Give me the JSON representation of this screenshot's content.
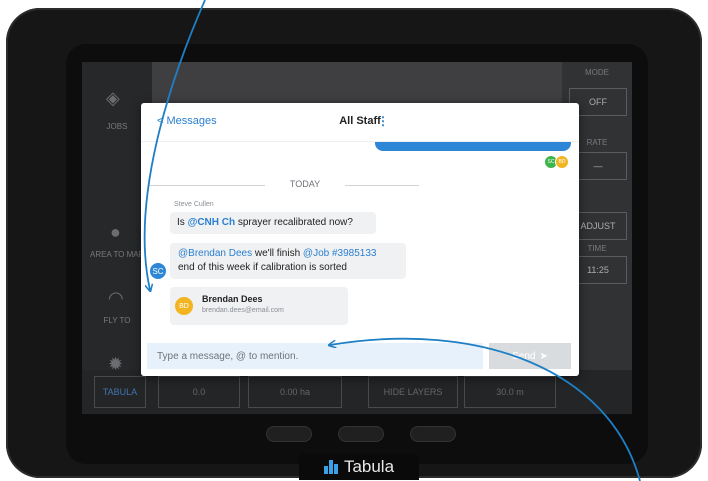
{
  "background": {
    "left_items": [
      "JOBS",
      "AREA TO MAP",
      "FLY TO"
    ],
    "right_values": [
      "OFF",
      "—",
      "11:25"
    ],
    "right_labels": [
      "MODE",
      "RATE",
      "TIME"
    ],
    "right_button": "ADJUST",
    "bottom_values": [
      "0.0",
      "0.00 ha",
      "HIDE LAYERS",
      "30.0 m"
    ],
    "bottom_left": "TABULA"
  },
  "header": {
    "back_label": "< Messages",
    "title": "All Staff",
    "menu_icon": "⋮"
  },
  "divider_label": "TODAY",
  "avatars_small": [
    "BD",
    "SC"
  ],
  "messages": {
    "sender": "Steve Cullen",
    "msg1": {
      "pre": "Is ",
      "mention": "@CNH Ch",
      "post": " sprayer recalibrated now?"
    },
    "msg2": {
      "mention1": "@Brendan Dees",
      "text1": " we'll finish ",
      "mention2": "@Job #3985133",
      "line2": "end of this week if calibration is sorted"
    },
    "avatar": "SC"
  },
  "mention_card": {
    "avatar": "BD",
    "name": "Brendan Dees",
    "email": "brendan.dees@email.com"
  },
  "composer": {
    "placeholder": "Type a message, @ to mention.",
    "send_label": "Send",
    "send_icon": "➤"
  },
  "brand": "Tabula",
  "colors": {
    "accent": "#2a7fd0",
    "bubble_out": "#2d86d6",
    "avatar_yellow": "#f3b421",
    "avatar_green": "#3cb54a",
    "input_bg": "#e7f1fb",
    "arrow": "#1f7fc4"
  }
}
